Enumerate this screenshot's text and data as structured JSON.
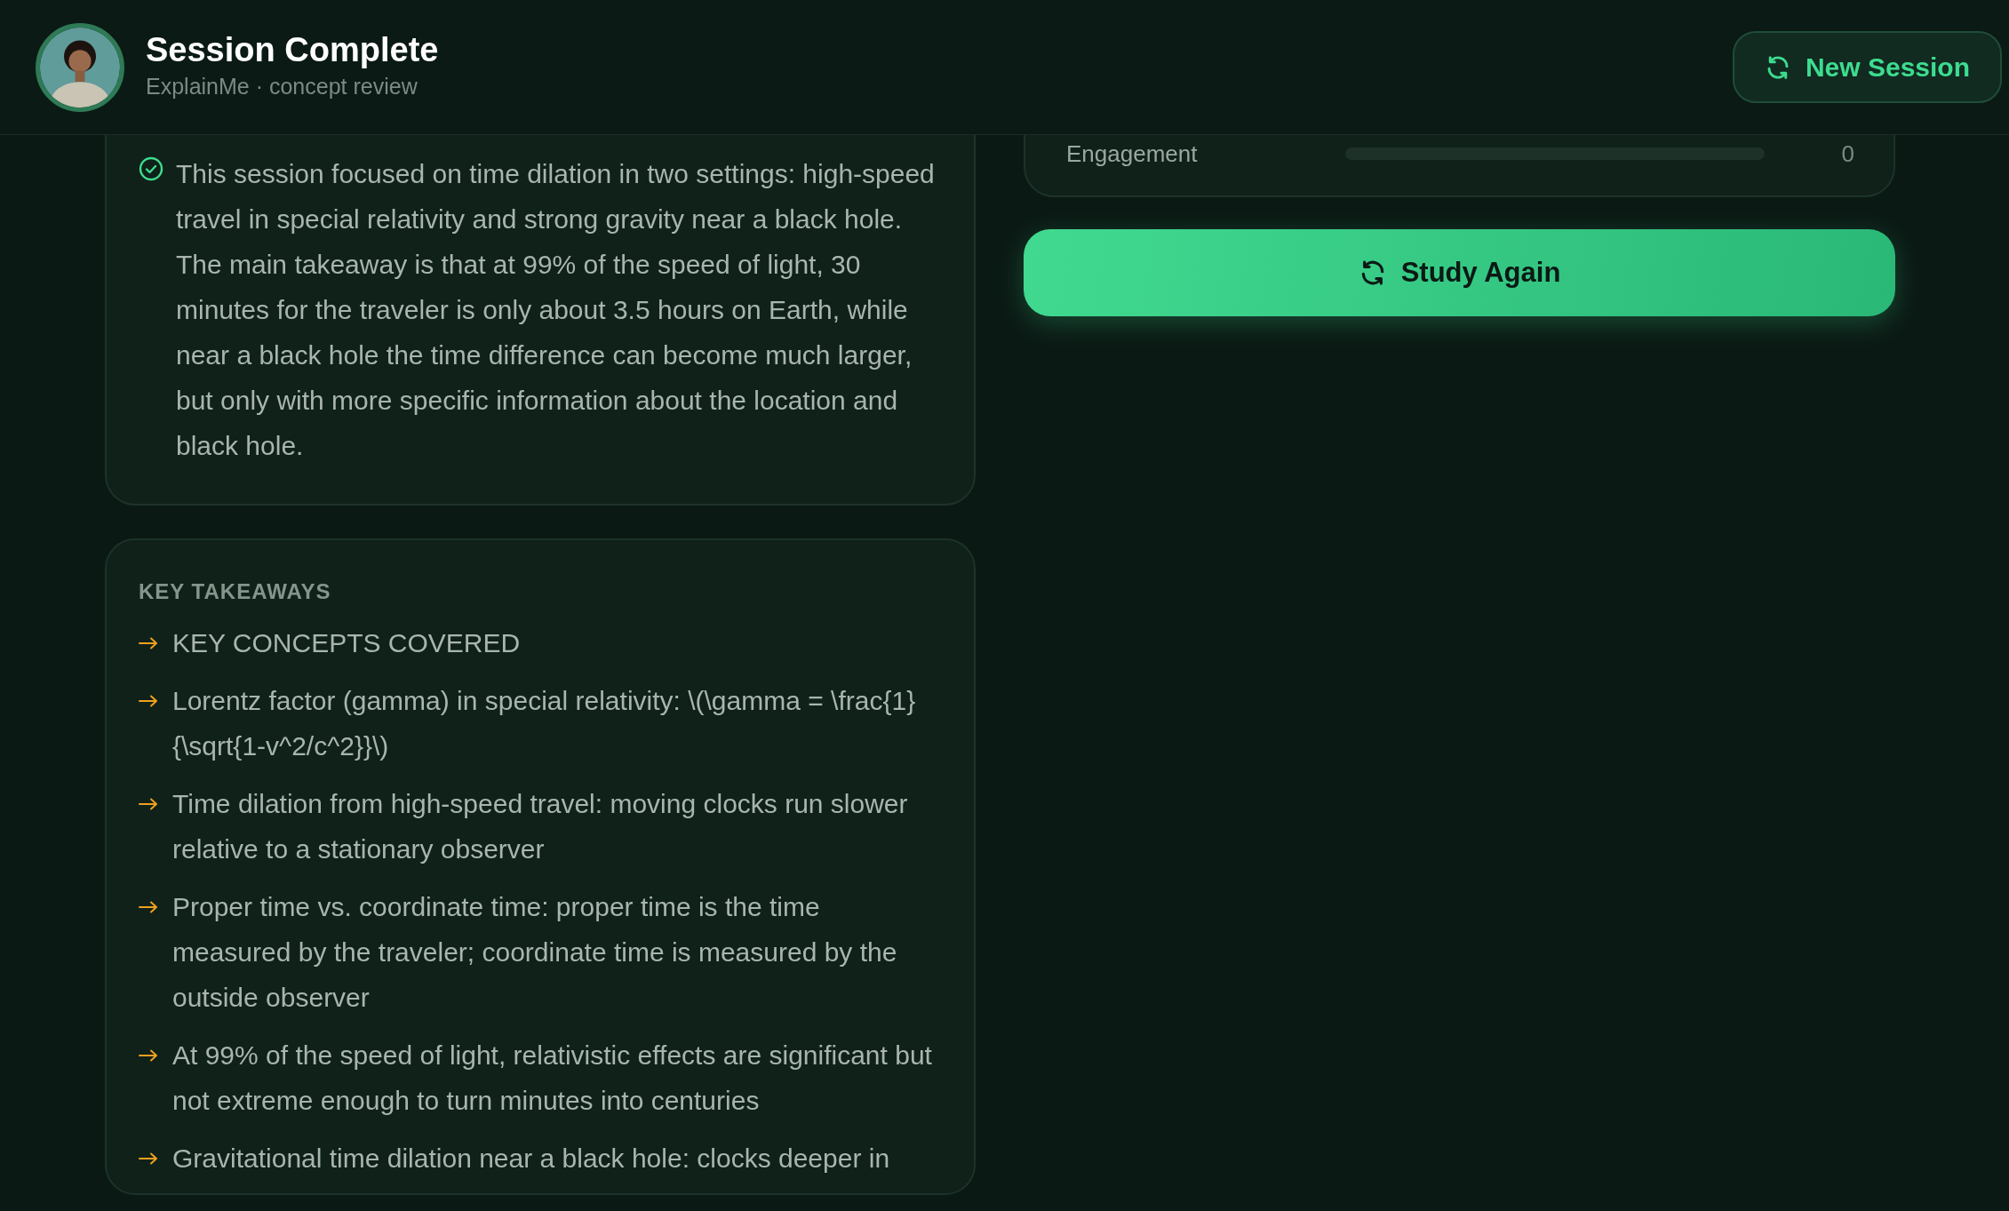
{
  "header": {
    "title": "Session Complete",
    "subtitle": "ExplainMe · concept review",
    "button": "New Session"
  },
  "summary": {
    "text": "This session focused on time dilation in two settings: high-speed travel in special relativity and strong gravity near a black hole. The main takeaway is that at 99% of the speed of light, 30 minutes for the traveler is only about 3.5 hours on Earth, while near a black hole the time difference can become much larger, but only with more specific information about the location and black hole.",
    "complete": true
  },
  "takeaways": {
    "heading": "KEY TAKEAWAYS",
    "items": [
      "KEY CONCEPTS COVERED",
      "Lorentz factor (gamma) in special relativity: \\(\\gamma = \\frac{1}{\\sqrt{1-v^2/c^2}}\\)",
      "Time dilation from high-speed travel: moving clocks run slower relative to a stationary observer",
      "Proper time vs. coordinate time: proper time is the time measured by the traveler; coordinate time is measured by the outside observer",
      "At 99% of the speed of light, relativistic effects are significant but not extreme enough to turn minutes into centuries",
      "Gravitational time dilation near a black hole: clocks deeper in"
    ]
  },
  "metrics": [
    {
      "label": "Engagement",
      "level": 0,
      "value": "0"
    }
  ],
  "study_button": "Study Again"
}
